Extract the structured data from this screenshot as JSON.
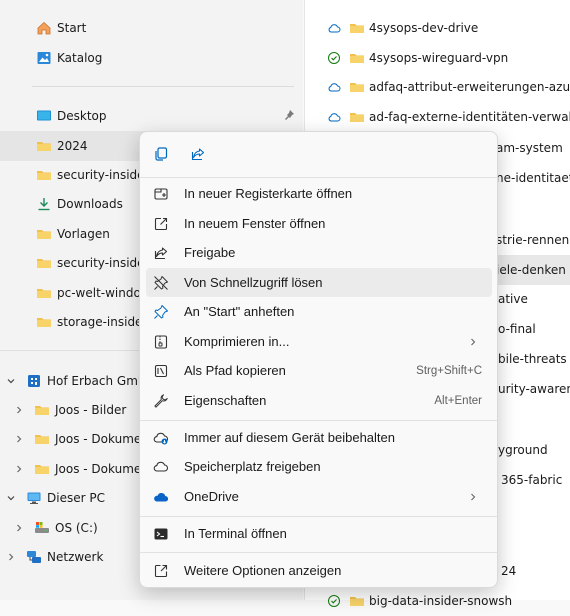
{
  "nav": {
    "start": "Start",
    "katalog": "Katalog",
    "desktop": "Desktop",
    "folder_2024": "2024",
    "security_new": "security-insider-new",
    "downloads": "Downloads",
    "vorlagen": "Vorlagen",
    "security_aud": "security-insider-aud",
    "pc_welt": "pc-welt-windows-f",
    "storage": "storage-insider-tipp",
    "hof": "Hof Erbach GmbH",
    "joos_bilder": "Joos - Bilder",
    "joos_dok1": "Joos - Dokumente",
    "joos_dok2": "Joos - Dokumente",
    "dieser_pc": "Dieser PC",
    "os_c": "OS (C:)",
    "netzwerk": "Netzwerk"
  },
  "files": [
    {
      "name": "4sysops-dev-drive",
      "status": "cloud"
    },
    {
      "name": "4sysops-wireguard-vpn",
      "status": "synced"
    },
    {
      "name": "adfaq-attribut-erweiterungen-azure-ad-en",
      "status": "cloud"
    },
    {
      "name": "ad-faq-externe-identitäten-verwalten",
      "status": "cloud"
    }
  ],
  "partial_files": {
    "r5": "am-system",
    "r6": "ne-identitaeten",
    "r8": "strie-rennen",
    "r9": "iele-denken",
    "r10": "ative",
    "r11": "o-final",
    "r12": "bile-threats",
    "r13": "urity-awareness",
    "r15": "yground",
    "r16": "365-fabric",
    "r19": "24",
    "r20": "big-data-insider-snowsh"
  },
  "menu": {
    "items": [
      {
        "label": "In neuer Registerkarte öffnen"
      },
      {
        "label": "In neuem Fenster öffnen"
      },
      {
        "label": "Freigabe"
      },
      {
        "label": "Von Schnellzugriff lösen"
      },
      {
        "label": "An \"Start\" anheften"
      },
      {
        "label": "Komprimieren in..."
      },
      {
        "label": "Als Pfad kopieren",
        "shortcut": "Strg+Shift+C"
      },
      {
        "label": "Eigenschaften",
        "shortcut": "Alt+Enter"
      },
      {
        "label": "Immer auf diesem Gerät beibehalten"
      },
      {
        "label": "Speicherplatz freigeben"
      },
      {
        "label": "OneDrive"
      },
      {
        "label": "In Terminal öffnen"
      },
      {
        "label": "Weitere Optionen anzeigen"
      }
    ]
  },
  "colors": {
    "folder": "#f0c14b",
    "accent": "#0067c0",
    "synced": "#107c10"
  }
}
